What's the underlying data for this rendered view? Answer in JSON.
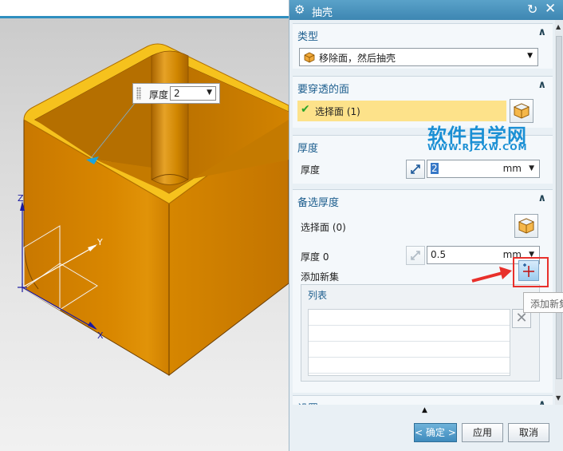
{
  "viewport": {
    "inline_thickness": {
      "label": "厚度",
      "value": "2"
    },
    "axes": {
      "z": "Z",
      "y": "Y",
      "x": "X"
    }
  },
  "dialog": {
    "title": "抽壳",
    "sections": {
      "type": {
        "title": "类型",
        "selected": "移除面，然后抽壳"
      },
      "pierce_faces": {
        "title": "要穿透的面",
        "select_label": "选择面 (1)"
      },
      "thickness": {
        "title": "厚度",
        "label": "厚度",
        "value": "2",
        "unit": "mm"
      },
      "alt_thickness": {
        "title": "备选厚度",
        "select_label": "选择面 (0)",
        "thickness_label": "厚度 0",
        "thickness_value": "0.5",
        "unit": "mm",
        "add_set_label": "添加新集",
        "list_title": "列表"
      },
      "settings": {
        "title": "设置"
      }
    },
    "buttons": {
      "ok": "< 确定 >",
      "apply": "应用",
      "cancel": "取消"
    },
    "tooltip": "添加新集"
  },
  "watermark": {
    "line1": "软件自学网",
    "line2": "WWW.RJZXW.COM"
  },
  "colors": {
    "model_orange": "#d98700",
    "rim_yellow": "#f6c21d",
    "selection_highlight": "#fde28a",
    "title_bar": "#3d86b2",
    "annotation_red": "#e8302b"
  }
}
